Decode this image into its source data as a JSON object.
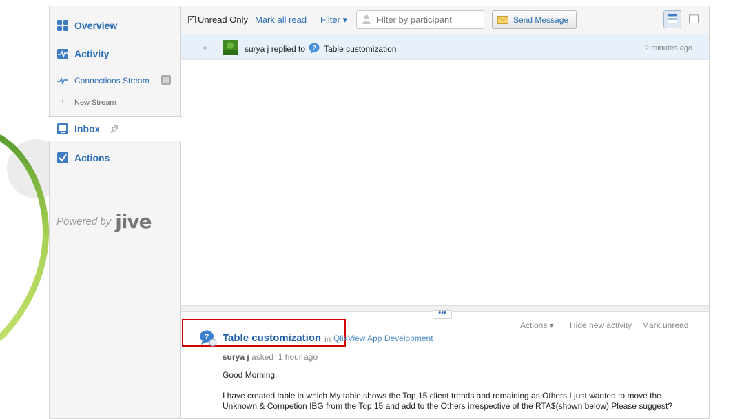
{
  "sidebar": {
    "items": [
      {
        "label": "Overview"
      },
      {
        "label": "Activity"
      },
      {
        "label": "Connections Stream"
      },
      {
        "label": "New Stream"
      },
      {
        "label": "Inbox"
      },
      {
        "label": "Actions"
      }
    ],
    "powered_by": "Powered by",
    "brand": "jive"
  },
  "toolbar": {
    "unread_only": "Unread Only",
    "mark_all_read": "Mark all read",
    "filter": "Filter ▾",
    "filter_placeholder": "Filter by participant",
    "send_message": "Send Message"
  },
  "messages": [
    {
      "author": "surya j",
      "action": "replied to",
      "subject": "Table customization",
      "time": "2 minutes ago"
    }
  ],
  "detail": {
    "actions": [
      "Actions ▾",
      "Hide new activity",
      "Mark unread"
    ],
    "title": "Table customization",
    "in_label": "in",
    "place": "QlikView App Development",
    "author": "surya j",
    "verb": "asked",
    "time": "1 hour ago",
    "greeting": "Good Morning,",
    "body_line1": "I have created table in which My table shows the Top 15 client trends and remaining as Others.I just wanted to move the",
    "body_line2": "Unknown & Competion IBG from the Top 15 and add to the Others irrespective of the RTA$(shown below).Please suggest?"
  },
  "colors": {
    "link": "#2a6db3",
    "selected_row": "#e8f0fa",
    "highlight_box": "#d40000",
    "arc_green": "#8dc63f"
  },
  "icons": [
    "overview-icon",
    "activity-icon",
    "stream-icon",
    "plus-icon",
    "inbox-icon",
    "pin-icon",
    "actions-icon",
    "person-icon",
    "envelope-icon",
    "split-view-icon",
    "single-view-icon",
    "question-bubble-icon",
    "avatar"
  ]
}
